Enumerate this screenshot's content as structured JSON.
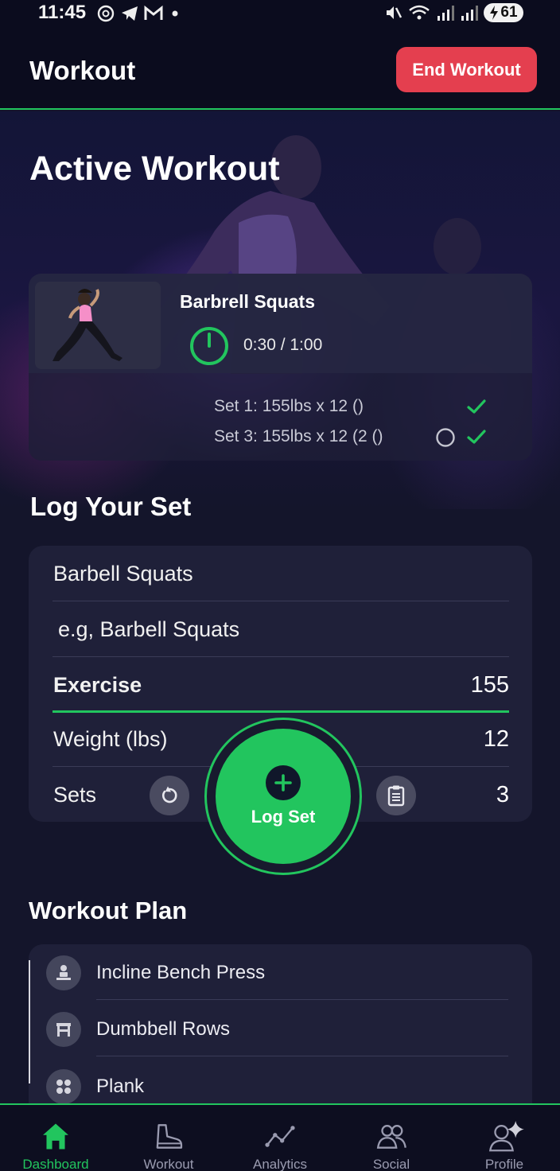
{
  "status_bar": {
    "time": "11:45",
    "battery": "61"
  },
  "header": {
    "title": "Workout",
    "end_button": "End Workout"
  },
  "active": {
    "title": "Active Workout",
    "exercise_name": "Barbrell Squats",
    "timer": "0:30 / 1:00",
    "sets": [
      {
        "text": "Set 1: 155lbs x 12 ()",
        "done": true
      },
      {
        "text": "Set 3: 155lbs x 12 (2 ()",
        "done": true
      }
    ]
  },
  "log": {
    "title": "Log Your Set",
    "exercise_value": "Barbell Squats",
    "exercise_placeholder": "e.g, Barbell Squats",
    "rows": [
      {
        "label": "Exercise",
        "value": "155"
      },
      {
        "label": "Weight (lbs)",
        "value": "12"
      },
      {
        "label": "Sets",
        "value": "3"
      }
    ],
    "log_button": "Log Set"
  },
  "plan": {
    "title": "Workout Plan",
    "items": [
      {
        "label": "Incline Bench Press",
        "icon": "bench-icon"
      },
      {
        "label": "Dumbbell Rows",
        "icon": "rows-icon"
      },
      {
        "label": "Plank",
        "icon": "plank-icon"
      }
    ]
  },
  "nav": {
    "items": [
      {
        "label": "Dashboard",
        "icon": "home-icon",
        "active": true
      },
      {
        "label": "Workout",
        "icon": "shoe-icon",
        "active": false
      },
      {
        "label": "Analytics",
        "icon": "chart-line-icon",
        "active": false
      },
      {
        "label": "Social",
        "icon": "people-icon",
        "active": false
      },
      {
        "label": "Profile",
        "icon": "profile-icon",
        "active": false
      }
    ]
  },
  "colors": {
    "accent": "#22c55e",
    "danger": "#e43f4f",
    "background": "#14152b",
    "card": "#1f2039"
  }
}
